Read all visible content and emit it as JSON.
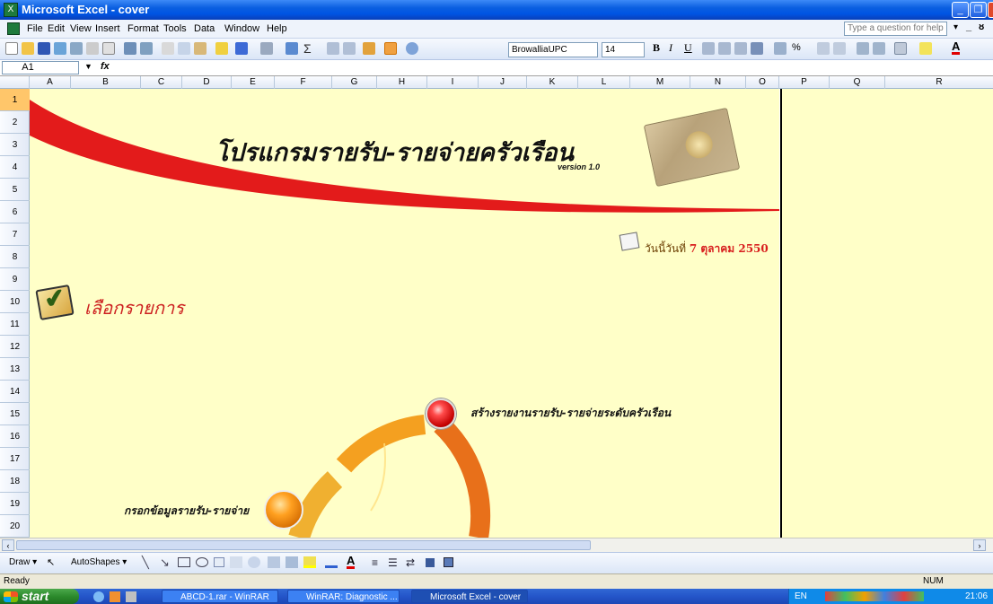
{
  "window": {
    "title": "Microsoft Excel - cover",
    "app_icon": "excel-icon",
    "controls": [
      "minimize-icon",
      "restore-icon",
      "close-icon"
    ]
  },
  "menubar": {
    "items": [
      "File",
      "Edit",
      "View",
      "Insert",
      "Format",
      "Tools",
      "Data",
      "Window",
      "Help"
    ],
    "help_placeholder": "Type a question for help"
  },
  "toolbar": {
    "font_name": "BrowalliaUPC",
    "font_size": "14",
    "format_buttons": [
      "B",
      "I",
      "U"
    ],
    "percent": "%"
  },
  "formula_bar": {
    "cell_ref": "A1",
    "fx_label": "fx"
  },
  "grid": {
    "columns": [
      "A",
      "B",
      "C",
      "D",
      "E",
      "F",
      "G",
      "H",
      "I",
      "J",
      "K",
      "L",
      "M",
      "N",
      "O",
      "P",
      "Q",
      "R"
    ],
    "rows": [
      "1",
      "2",
      "3",
      "4",
      "5",
      "6",
      "7",
      "8",
      "9",
      "10",
      "11",
      "12",
      "13",
      "14",
      "15",
      "16",
      "17",
      "18",
      "19",
      "20"
    ]
  },
  "sheet": {
    "title": "โปรแกรมรายรับ-รายจ่ายครัวเรือน",
    "version": "version 1.0",
    "date_prefix": "วันนี้วันที่",
    "date_value": "7 ตุลาคม 2550",
    "menu_heading": "เลือกรายการ",
    "option_report": "สร้างรายงานรายรับ-รายจ่ายระดับครัวเรือน",
    "option_entry": "กรอกข้อมูลรายรับ-รายจ่าย"
  },
  "draw_toolbar": {
    "draw_label": "Draw ▾",
    "autoshapes_label": "AutoShapes ▾"
  },
  "statusbar": {
    "status": "Ready",
    "num": "NUM"
  },
  "taskbar": {
    "start": "start",
    "tasks": [
      "ABCD-1.rar - WinRAR",
      "WinRAR: Diagnostic ...",
      "Microsoft Excel - cover"
    ],
    "lang": "EN",
    "clock": "21:06"
  },
  "colors": {
    "sheet_bg": "#ffffc8",
    "accent_red": "#e31b1b",
    "title_blue": "#0054e3"
  }
}
